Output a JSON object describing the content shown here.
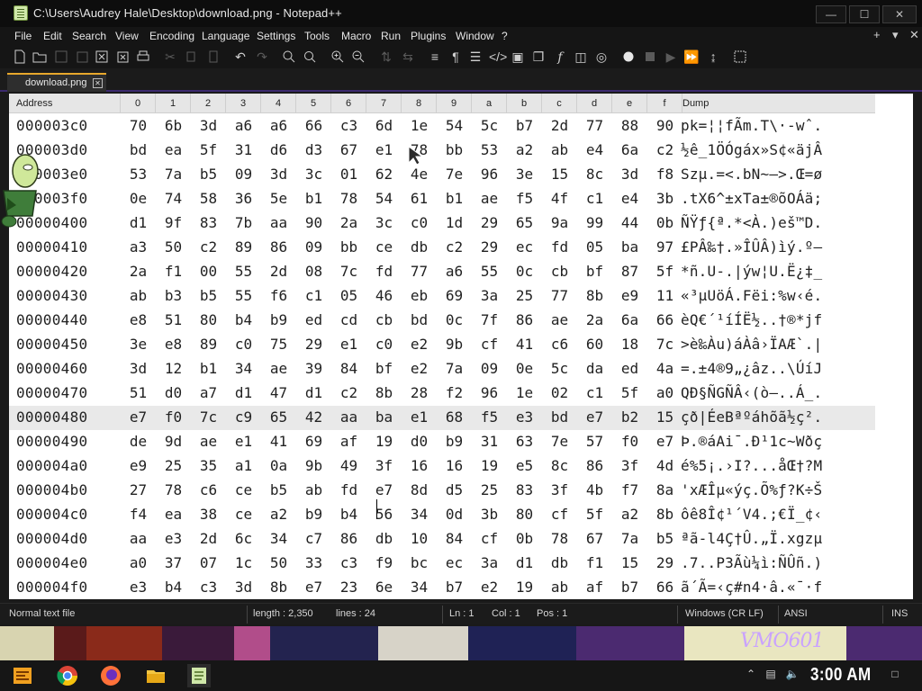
{
  "window": {
    "title": "C:\\Users\\Audrey Hale\\Desktop\\download.png - Notepad++",
    "controls": {
      "minimize": "—",
      "maximize": "☐",
      "close": "✕"
    }
  },
  "menu": {
    "items": [
      "File",
      "Edit",
      "Search",
      "View",
      "Encoding",
      "Language",
      "Settings",
      "Tools",
      "Macro",
      "Run",
      "Plugins",
      "Window",
      "?"
    ],
    "right": [
      "+",
      "▾",
      "✕"
    ]
  },
  "toolbar": {
    "icons": [
      "new-file-icon",
      "open-file-icon",
      "save-icon",
      "save-all-icon",
      "close-icon",
      "close-all-icon",
      "print-icon",
      "cut-icon",
      "copy-icon",
      "paste-icon",
      "undo-icon",
      "redo-icon",
      "find-icon",
      "replace-icon",
      "zoom-in-icon",
      "zoom-out-icon",
      "sync-vertical-icon",
      "sync-horizontal-icon",
      "word-wrap-icon",
      "show-all-chars-icon",
      "indent-guide-icon",
      "xml-tag-icon",
      "doc-map-icon",
      "document-list-icon",
      "function-list-icon",
      "folder-workspace-icon",
      "monitor-icon",
      "record-macro-icon",
      "stop-record-icon",
      "play-macro-icon",
      "run-macro-multiple-icon",
      "save-macro-icon"
    ]
  },
  "tab": {
    "label": "download.png"
  },
  "hex_view": {
    "header": {
      "address": "Address",
      "columns": [
        "0",
        "1",
        "2",
        "3",
        "4",
        "5",
        "6",
        "7",
        "8",
        "9",
        "a",
        "b",
        "c",
        "d",
        "e",
        "f"
      ],
      "dump": "Dump"
    },
    "rows": [
      {
        "addr": "000003c0",
        "bytes": [
          "70",
          "6b",
          "3d",
          "a6",
          "a6",
          "66",
          "c3",
          "6d",
          "1e",
          "54",
          "5c",
          "b7",
          "2d",
          "77",
          "88",
          "90"
        ],
        "dump": "pk=¦¦fÃm.T\\·-wˆ."
      },
      {
        "addr": "000003d0",
        "bytes": [
          "bd",
          "ea",
          "5f",
          "31",
          "d6",
          "d3",
          "67",
          "e1",
          "78",
          "bb",
          "53",
          "a2",
          "ab",
          "e4",
          "6a",
          "c2"
        ],
        "dump": "½ê_1ÖÓgáx»S¢«äjÂ"
      },
      {
        "addr": "000003e0",
        "bytes": [
          "53",
          "7a",
          "b5",
          "09",
          "3d",
          "3c",
          "01",
          "62",
          "4e",
          "7e",
          "96",
          "3e",
          "15",
          "8c",
          "3d",
          "f8"
        ],
        "dump": "Szµ.=<.bN~–>.Œ=ø"
      },
      {
        "addr": "000003f0",
        "bytes": [
          "0e",
          "74",
          "58",
          "36",
          "5e",
          "b1",
          "78",
          "54",
          "61",
          "b1",
          "ae",
          "f5",
          "4f",
          "c1",
          "e4",
          "3b"
        ],
        "dump": ".tX6^±xTa±®õOÁä;"
      },
      {
        "addr": "00000400",
        "bytes": [
          "d1",
          "9f",
          "83",
          "7b",
          "aa",
          "90",
          "2a",
          "3c",
          "c0",
          "1d",
          "29",
          "65",
          "9a",
          "99",
          "44",
          "0b"
        ],
        "dump": "ÑŸƒ{ª.*<À.)eš™D."
      },
      {
        "addr": "00000410",
        "bytes": [
          "a3",
          "50",
          "c2",
          "89",
          "86",
          "09",
          "bb",
          "ce",
          "db",
          "c2",
          "29",
          "ec",
          "fd",
          "05",
          "ba",
          "97"
        ],
        "dump": "£PÂ‰†.»ÎÛÂ)ìý.º—"
      },
      {
        "addr": "00000420",
        "bytes": [
          "2a",
          "f1",
          "00",
          "55",
          "2d",
          "08",
          "7c",
          "fd",
          "77",
          "a6",
          "55",
          "0c",
          "cb",
          "bf",
          "87",
          "5f"
        ],
        "dump": "*ñ.U-.|ýw¦U.Ë¿‡_"
      },
      {
        "addr": "00000430",
        "bytes": [
          "ab",
          "b3",
          "b5",
          "55",
          "f6",
          "c1",
          "05",
          "46",
          "eb",
          "69",
          "3a",
          "25",
          "77",
          "8b",
          "e9",
          "11"
        ],
        "dump": "«³µUöÁ.Fëi:%w‹é."
      },
      {
        "addr": "00000440",
        "bytes": [
          "e8",
          "51",
          "80",
          "b4",
          "b9",
          "ed",
          "cd",
          "cb",
          "bd",
          "0c",
          "7f",
          "86",
          "ae",
          "2a",
          "6a",
          "66"
        ],
        "dump": "èQ€´¹íÍË½..†®*jf"
      },
      {
        "addr": "00000450",
        "bytes": [
          "3e",
          "e8",
          "89",
          "c0",
          "75",
          "29",
          "e1",
          "c0",
          "e2",
          "9b",
          "cf",
          "41",
          "c6",
          "60",
          "18",
          "7c"
        ],
        "dump": ">è‰Àu)áÀâ›ÏAÆ`.|"
      },
      {
        "addr": "00000460",
        "bytes": [
          "3d",
          "12",
          "b1",
          "34",
          "ae",
          "39",
          "84",
          "bf",
          "e2",
          "7a",
          "09",
          "0e",
          "5c",
          "da",
          "ed",
          "4a"
        ],
        "dump": "=.±4®9„¿âz..\\ÚíJ"
      },
      {
        "addr": "00000470",
        "bytes": [
          "51",
          "d0",
          "a7",
          "d1",
          "47",
          "d1",
          "c2",
          "8b",
          "28",
          "f2",
          "96",
          "1e",
          "02",
          "c1",
          "5f",
          "a0"
        ],
        "dump": "QÐ§ÑGÑÂ‹(ò–..Á_."
      },
      {
        "addr": "00000480",
        "bytes": [
          "e7",
          "f0",
          "7c",
          "c9",
          "65",
          "42",
          "aa",
          "ba",
          "e1",
          "68",
          "f5",
          "e3",
          "bd",
          "e7",
          "b2",
          "15"
        ],
        "dump": "çð|ÉeBªºáhõã½ç²."
      },
      {
        "addr": "00000490",
        "bytes": [
          "de",
          "9d",
          "ae",
          "e1",
          "41",
          "69",
          "af",
          "19",
          "d0",
          "b9",
          "31",
          "63",
          "7e",
          "57",
          "f0",
          "e7"
        ],
        "dump": "Þ.®áAi¯.Ð¹1c~Wðç"
      },
      {
        "addr": "000004a0",
        "bytes": [
          "e9",
          "25",
          "35",
          "a1",
          "0a",
          "9b",
          "49",
          "3f",
          "16",
          "16",
          "19",
          "e5",
          "8c",
          "86",
          "3f",
          "4d"
        ],
        "dump": "é%5¡.›I?...åŒ†?M"
      },
      {
        "addr": "000004b0",
        "bytes": [
          "27",
          "78",
          "c6",
          "ce",
          "b5",
          "ab",
          "fd",
          "e7",
          "8d",
          "d5",
          "25",
          "83",
          "3f",
          "4b",
          "f7",
          "8a"
        ],
        "dump": "'xÆÎµ«ýç.Õ%ƒ?K÷Š"
      },
      {
        "addr": "000004c0",
        "bytes": [
          "f4",
          "ea",
          "38",
          "ce",
          "a2",
          "b9",
          "b4",
          "56",
          "34",
          "0d",
          "3b",
          "80",
          "cf",
          "5f",
          "a2",
          "8b"
        ],
        "dump": "ôê8Î¢¹´V4.;€Ï_¢‹"
      },
      {
        "addr": "000004d0",
        "bytes": [
          "aa",
          "e3",
          "2d",
          "6c",
          "34",
          "c7",
          "86",
          "db",
          "10",
          "84",
          "cf",
          "0b",
          "78",
          "67",
          "7a",
          "b5"
        ],
        "dump": "ªã-l4Ç†Û.„Ï.xgzµ"
      },
      {
        "addr": "000004e0",
        "bytes": [
          "a0",
          "37",
          "07",
          "1c",
          "50",
          "33",
          "c3",
          "f9",
          "bc",
          "ec",
          "3a",
          "d1",
          "db",
          "f1",
          "15",
          "29"
        ],
        "dump": ".7..P3Ãù¼ì:ÑÛñ.)"
      },
      {
        "addr": "000004f0",
        "bytes": [
          "e3",
          "b4",
          "c3",
          "3d",
          "8b",
          "e7",
          "23",
          "6e",
          "34",
          "b7",
          "e2",
          "19",
          "ab",
          "af",
          "b7",
          "66"
        ],
        "dump": "ã´Ã=‹ç#n4·â.«¯·f"
      }
    ]
  },
  "statusbar": {
    "file_type": "Normal text file",
    "length": "length : 2,350",
    "lines": "lines : 24",
    "ln": "Ln : 1",
    "col": "Col : 1",
    "pos": "Pos : 1",
    "eol": "Windows (CR LF)",
    "encoding": "ANSI",
    "mode": "INS"
  },
  "wallpaper": {
    "text": "VMO601"
  },
  "taskbar": {
    "clock": "3:00 AM",
    "icons": [
      "start-icon",
      "chrome-icon",
      "firefox-icon",
      "file-explorer-icon",
      "notepadplusplus-icon"
    ],
    "tray": [
      "chevron-up-icon",
      "network-icon",
      "volume-icon",
      "notification-icon"
    ]
  },
  "colors": {
    "accent_tab": "#e8a72c",
    "tab_border": "#3b2a6e",
    "highlight_row": "#e9e9e9"
  }
}
